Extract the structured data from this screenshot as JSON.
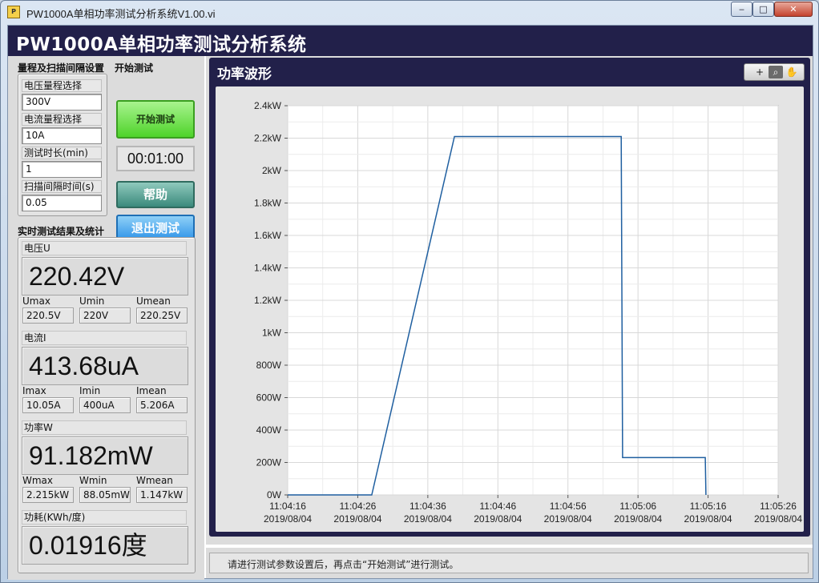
{
  "window": {
    "title": "PW1000A单相功率测试分析系统V1.00.vi",
    "icon": "labview-icon",
    "min": "‒",
    "max": "□",
    "close": "✕"
  },
  "header": {
    "title": "PW1000A单相功率测试分析系统"
  },
  "settings": {
    "section_label": "量程及扫描间隔设置",
    "voltage_range": {
      "label": "电压量程选择",
      "value": "300V"
    },
    "current_range": {
      "label": "电流量程选择",
      "value": "10A"
    },
    "duration": {
      "label": "测试时长(min)",
      "value": "1"
    },
    "interval": {
      "label": "扫描间隔时间(s)",
      "value": "0.05"
    }
  },
  "controls": {
    "section_label": "开始测试",
    "start_label": "开始测试",
    "timer": "00:01:00",
    "help_label": "帮助",
    "exit_label": "退出测试"
  },
  "results": {
    "section_label": "实时测试结果及统计",
    "voltage": {
      "label": "电压U",
      "value": "220.42V",
      "max_label": "Umax",
      "max": "220.5V",
      "min_label": "Umin",
      "min": "220V",
      "mean_label": "Umean",
      "mean": "220.25V"
    },
    "current": {
      "label": "电流I",
      "value": "413.68uA",
      "max_label": "Imax",
      "max": "10.05A",
      "min_label": "Imin",
      "min": "400uA",
      "mean_label": "Imean",
      "mean": "5.206A"
    },
    "power": {
      "label": "功率W",
      "value": "91.182mW",
      "max_label": "Wmax",
      "max": "2.215kW",
      "min_label": "Wmin",
      "min": "88.05mW",
      "mean_label": "Wmean",
      "mean": "1.147kW"
    },
    "energy": {
      "label": "功耗(KWh/度)",
      "value": "0.01916度"
    }
  },
  "chart_panel": {
    "title": "功率波形",
    "tools": [
      "+",
      "⌕",
      "✋"
    ]
  },
  "status": {
    "message": "请进行测试参数设置后，再点击“开始测试”进行测试。"
  },
  "colors": {
    "series": "#1f5fa0",
    "header_bg": "#22204a",
    "grid": "#dcdcdc"
  },
  "chart_data": {
    "type": "line",
    "title": "",
    "xlabel": "",
    "ylabel": "",
    "x_ticks": [
      {
        "time": "11:04:16",
        "date": "2019/08/04"
      },
      {
        "time": "11:04:26",
        "date": "2019/08/04"
      },
      {
        "time": "11:04:36",
        "date": "2019/08/04"
      },
      {
        "time": "11:04:46",
        "date": "2019/08/04"
      },
      {
        "time": "11:04:56",
        "date": "2019/08/04"
      },
      {
        "time": "11:05:06",
        "date": "2019/08/04"
      },
      {
        "time": "11:05:16",
        "date": "2019/08/04"
      },
      {
        "time": "11:05:26",
        "date": "2019/08/04"
      }
    ],
    "y_ticks": [
      "0W",
      "200W",
      "400W",
      "600W",
      "800W",
      "1kW",
      "1.2kW",
      "1.4kW",
      "1.6kW",
      "1.8kW",
      "2kW",
      "2.2kW",
      "2.4kW"
    ],
    "xlim_seconds": [
      0,
      70
    ],
    "ylim": [
      0,
      2400
    ],
    "grid": true,
    "series": [
      {
        "x_seconds": [
          0,
          11.9,
          12.0,
          23.8,
          47.6,
          47.8,
          59.6,
          59.7
        ],
        "values": [
          0.1,
          0.1,
          0,
          2210,
          2210,
          230,
          230,
          0
        ]
      }
    ]
  }
}
